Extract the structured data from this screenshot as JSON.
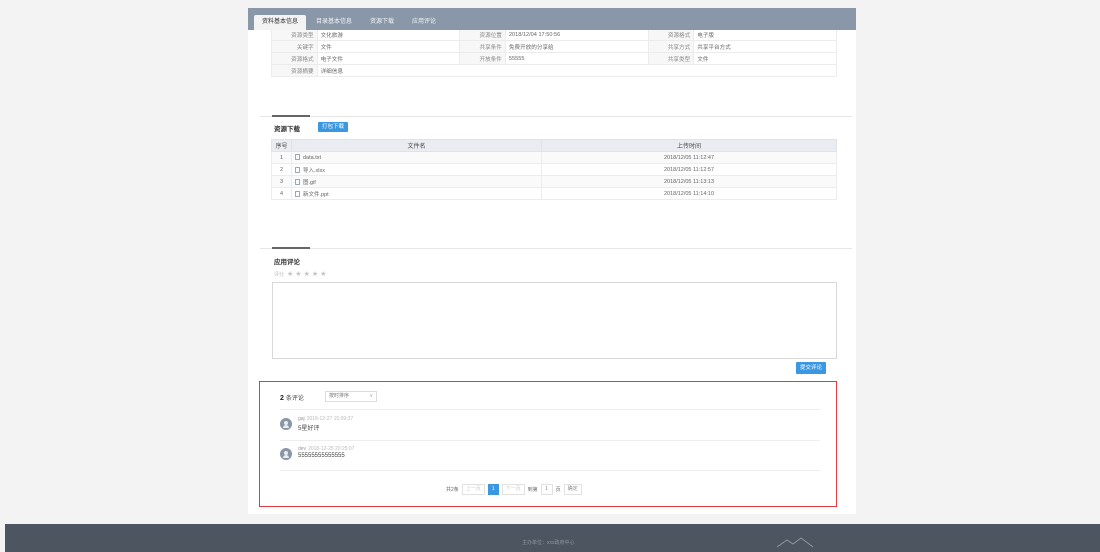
{
  "nav": {
    "tabs": [
      {
        "label": "资料基本信息",
        "active": true
      },
      {
        "label": "目录基本信息",
        "active": false
      },
      {
        "label": "资源下载",
        "active": false
      },
      {
        "label": "应用评论",
        "active": false
      }
    ]
  },
  "info": {
    "rows": [
      [
        "资源类型",
        "文化旅游",
        "资源位置",
        "2018/12/04 17:50:56",
        "资源格式",
        "电子版"
      ],
      [
        "关键字",
        "文件",
        "共享条件",
        "免费开放的分享给",
        "共享方式",
        "共享平台方式"
      ],
      [
        "资源格式",
        "电子文件",
        "开放条件",
        "55555",
        "共享类型",
        "文件"
      ],
      [
        "资源摘要",
        "详细信息",
        "",
        "",
        "",
        ""
      ]
    ]
  },
  "download": {
    "title": "资源下载",
    "pack_button": "打包下载",
    "headers": [
      "序号",
      "文件名",
      "上传时间"
    ],
    "files": [
      {
        "idx": "1",
        "name": "data.txt",
        "time": "2018/12/05 11:12:47"
      },
      {
        "idx": "2",
        "name": "导入.xlsx",
        "time": "2018/12/05 11:12:57"
      },
      {
        "idx": "3",
        "name": "图.gif",
        "time": "2018/12/05 11:13:13"
      },
      {
        "idx": "4",
        "name": "新文件.ppt",
        "time": "2018/12/05 11:14:10"
      }
    ]
  },
  "review": {
    "title": "应用评论",
    "rating_label": "评分",
    "stars": "★★★★★",
    "submit_button": "提交评论"
  },
  "comments": {
    "count": "2",
    "count_label": "条评论",
    "sort_label": "按时排序",
    "sort_chevron": "∨",
    "items": [
      {
        "user": "gaj",
        "time": "2018-12-27 15:09:37",
        "text": "5星好评"
      },
      {
        "user": "dev",
        "time": "2018-12-25 20:25:07",
        "text": "55555555555555"
      }
    ]
  },
  "pager": {
    "total": "共2条",
    "prev": "上一页",
    "current": "1",
    "next": "下一页",
    "goto_label": "到第",
    "goto_value": "1",
    "page_unit": "页",
    "confirm": "确定"
  },
  "footer": {
    "text": "主办单位：xxx政府中心"
  },
  "colors": {
    "accent": "#3b97e0",
    "highlight": "#e23b3b",
    "nav": "#8a97a8",
    "footer": "#4c5560"
  }
}
